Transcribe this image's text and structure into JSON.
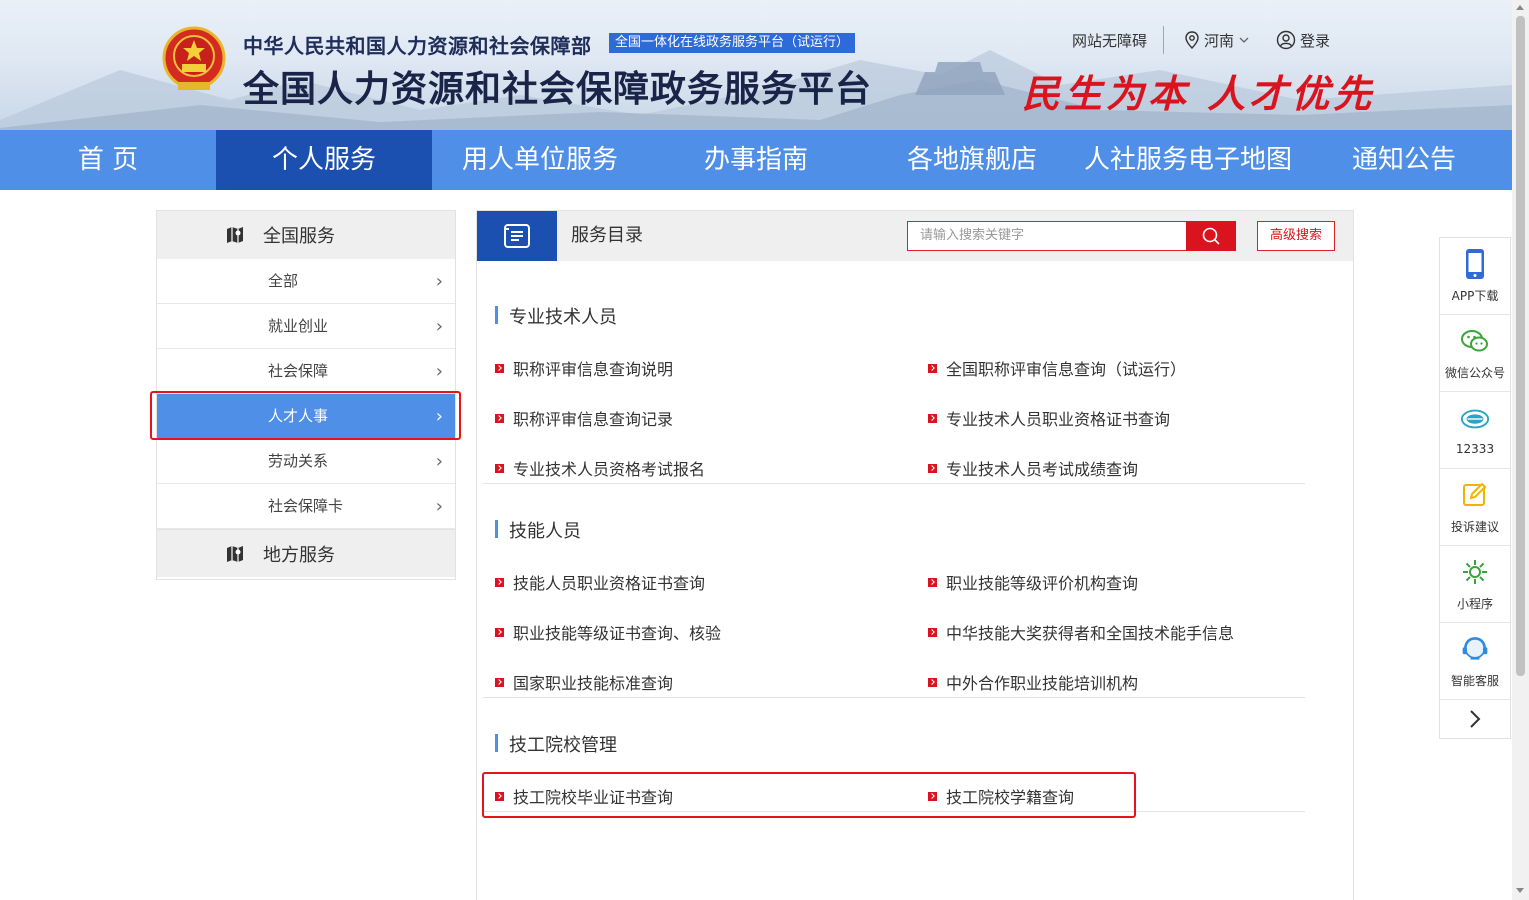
{
  "header": {
    "org_name": "中华人民共和国人力资源和社会保障部",
    "platform_badge": "全国一体化在线政务服务平台（试运行）",
    "site_title": "全国人力资源和社会保障政务服务平台",
    "slogan": "民生为本 人才优先",
    "accessibility": "网站无障碍",
    "location": "河南",
    "login": "登录"
  },
  "nav": {
    "items": [
      "首 页",
      "个人服务",
      "用人单位服务",
      "办事指南",
      "各地旗舰店",
      "人社服务电子地图",
      "通知公告"
    ],
    "active_index": 1
  },
  "sidebar": {
    "national_title": "全国服务",
    "items": [
      "全部",
      "就业创业",
      "社会保障",
      "人才人事",
      "劳动关系",
      "社会保障卡"
    ],
    "active_index": 3,
    "local_title": "地方服务"
  },
  "panel": {
    "title": "服务目录",
    "search_placeholder": "请输入搜索关键字",
    "advanced_search": "高级搜索",
    "sections": [
      {
        "title": "专业技术人员",
        "links": [
          "职称评审信息查询说明",
          "全国职称评审信息查询（试运行）",
          "职称评审信息查询记录",
          "专业技术人员职业资格证书查询",
          "专业技术人员资格考试报名",
          "专业技术人员考试成绩查询"
        ]
      },
      {
        "title": "技能人员",
        "links": [
          "技能人员职业资格证书查询",
          "职业技能等级评价机构查询",
          "职业技能等级证书查询、核验",
          "中华技能大奖获得者和全国技术能手信息",
          "国家职业技能标准查询",
          "中外合作职业技能培训机构"
        ]
      },
      {
        "title": "技工院校管理",
        "links": [
          "技工院校毕业证书查询",
          "技工院校学籍查询"
        ]
      }
    ]
  },
  "float_bar": {
    "items": [
      "APP下载",
      "微信公众号",
      "12333",
      "投诉建议",
      "小程序",
      "智能客服"
    ]
  },
  "colors": {
    "nav_blue": "#4f8fe8",
    "nav_active": "#1b4fb0",
    "accent_red": "#d9141e"
  }
}
